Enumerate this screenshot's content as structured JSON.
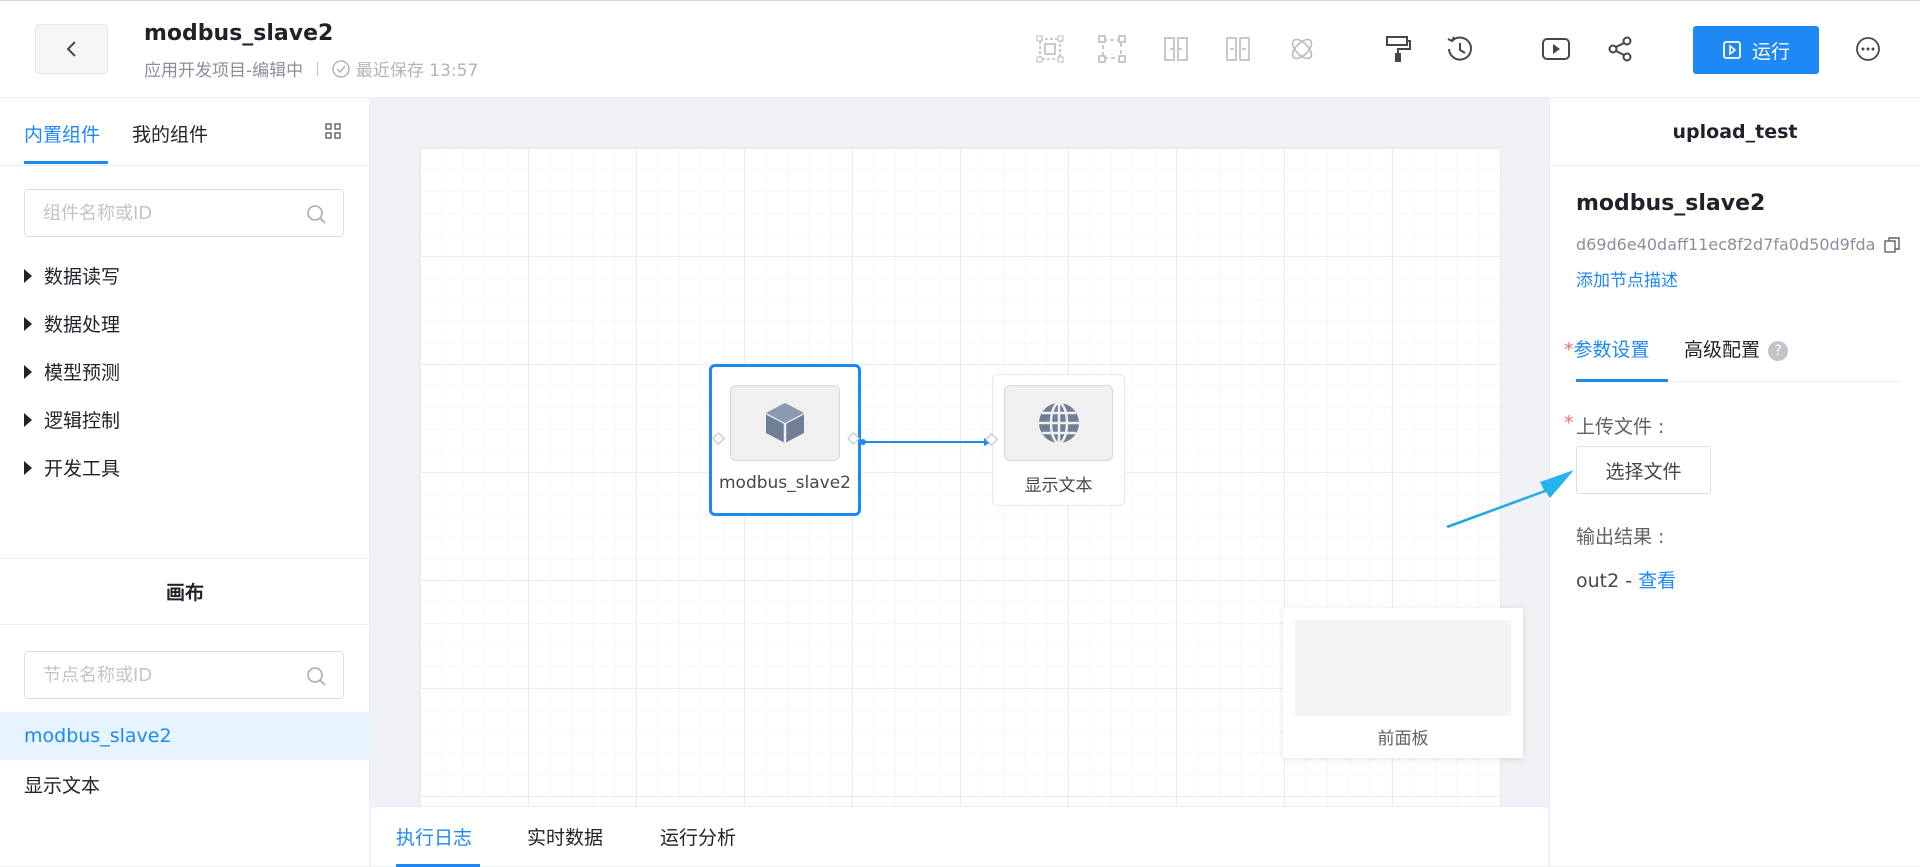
{
  "header": {
    "title": "modbus_slave2",
    "subtitle": "应用开发项目-编辑中",
    "separator": "|",
    "saved_text": "最近保存 13:57",
    "run_label": "运行",
    "accent_color": "#1e88f5"
  },
  "left": {
    "tabs": [
      "内置组件",
      "我的组件"
    ],
    "search_placeholder": "组件名称或ID",
    "categories": [
      "数据读写",
      "数据处理",
      "模型预测",
      "逻辑控制",
      "开发工具"
    ],
    "canvas_title": "画布",
    "node_search_placeholder": "节点名称或ID",
    "nodes": [
      "modbus_slave2",
      "显示文本"
    ]
  },
  "canvas": {
    "nodes": [
      {
        "label": "modbus_slave2",
        "icon": "cube-icon",
        "selected": true
      },
      {
        "label": "显示文本",
        "icon": "globe-icon",
        "selected": false
      }
    ],
    "front_panel_label": "前面板"
  },
  "bottom_tabs": [
    "执行日志",
    "实时数据",
    "运行分析"
  ],
  "right": {
    "header": "upload_test",
    "node_name": "modbus_slave2",
    "node_id": "d69d6e40daff11ec8f2d7fa0d50d9fda",
    "add_desc": "添加节点描述",
    "tabs": [
      "参数设置",
      "高级配置"
    ],
    "required_mark": "*",
    "upload_label": "上传文件 :",
    "choose_file": "选择文件",
    "output_label": "输出结果 :",
    "output_name": "out2 - ",
    "output_view": "查看"
  }
}
